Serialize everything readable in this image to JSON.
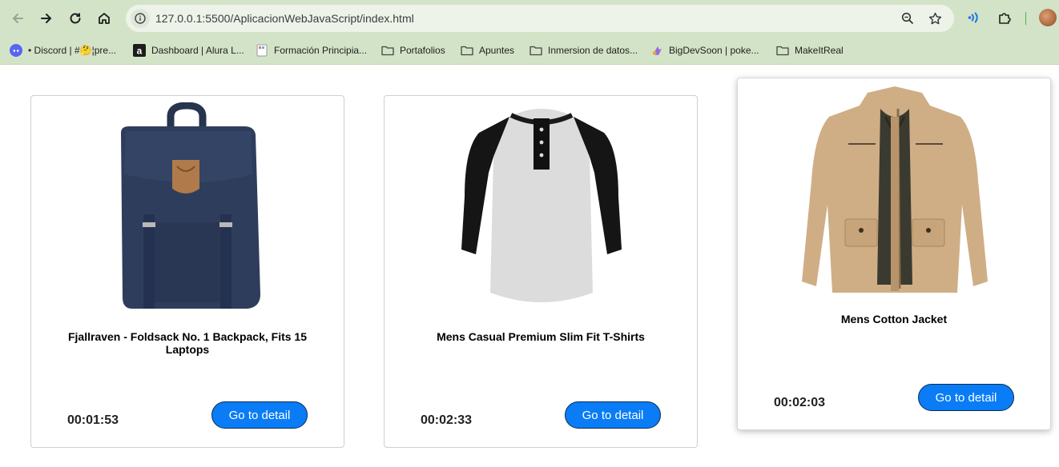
{
  "browser": {
    "url": "127.0.0.1:5500/AplicacionWebJavaScript/index.html",
    "bookmarks": [
      {
        "label": "• Discord | #🤔¦pre...",
        "icon": "discord-icon"
      },
      {
        "label": "Dashboard | Alura L...",
        "icon": "alura-icon"
      },
      {
        "label": "Formación Principia...",
        "icon": "page-icon"
      },
      {
        "label": "Portafolios",
        "icon": "folder-icon"
      },
      {
        "label": "Apuntes",
        "icon": "folder-icon"
      },
      {
        "label": "Inmersion de datos...",
        "icon": "folder-icon"
      },
      {
        "label": "BigDevSoon | poke...",
        "icon": "bigdevsoon-icon"
      },
      {
        "label": "MakeItReal",
        "icon": "folder-icon"
      }
    ]
  },
  "products": [
    {
      "title": "Fjallraven - Foldsack No. 1 Backpack, Fits 15 Laptops",
      "timer": "00:01:53",
      "button": "Go to detail",
      "image": "backpack-image"
    },
    {
      "title": "Mens Casual Premium Slim Fit T-Shirts",
      "timer": "00:02:33",
      "button": "Go to detail",
      "image": "tshirt-image"
    },
    {
      "title": "Mens Cotton Jacket",
      "timer": "00:02:03",
      "button": "Go to detail",
      "image": "jacket-image"
    }
  ],
  "colors": {
    "chrome": "#d3e3c7",
    "button": "#0a7cf6",
    "accent": "#4caf50"
  }
}
